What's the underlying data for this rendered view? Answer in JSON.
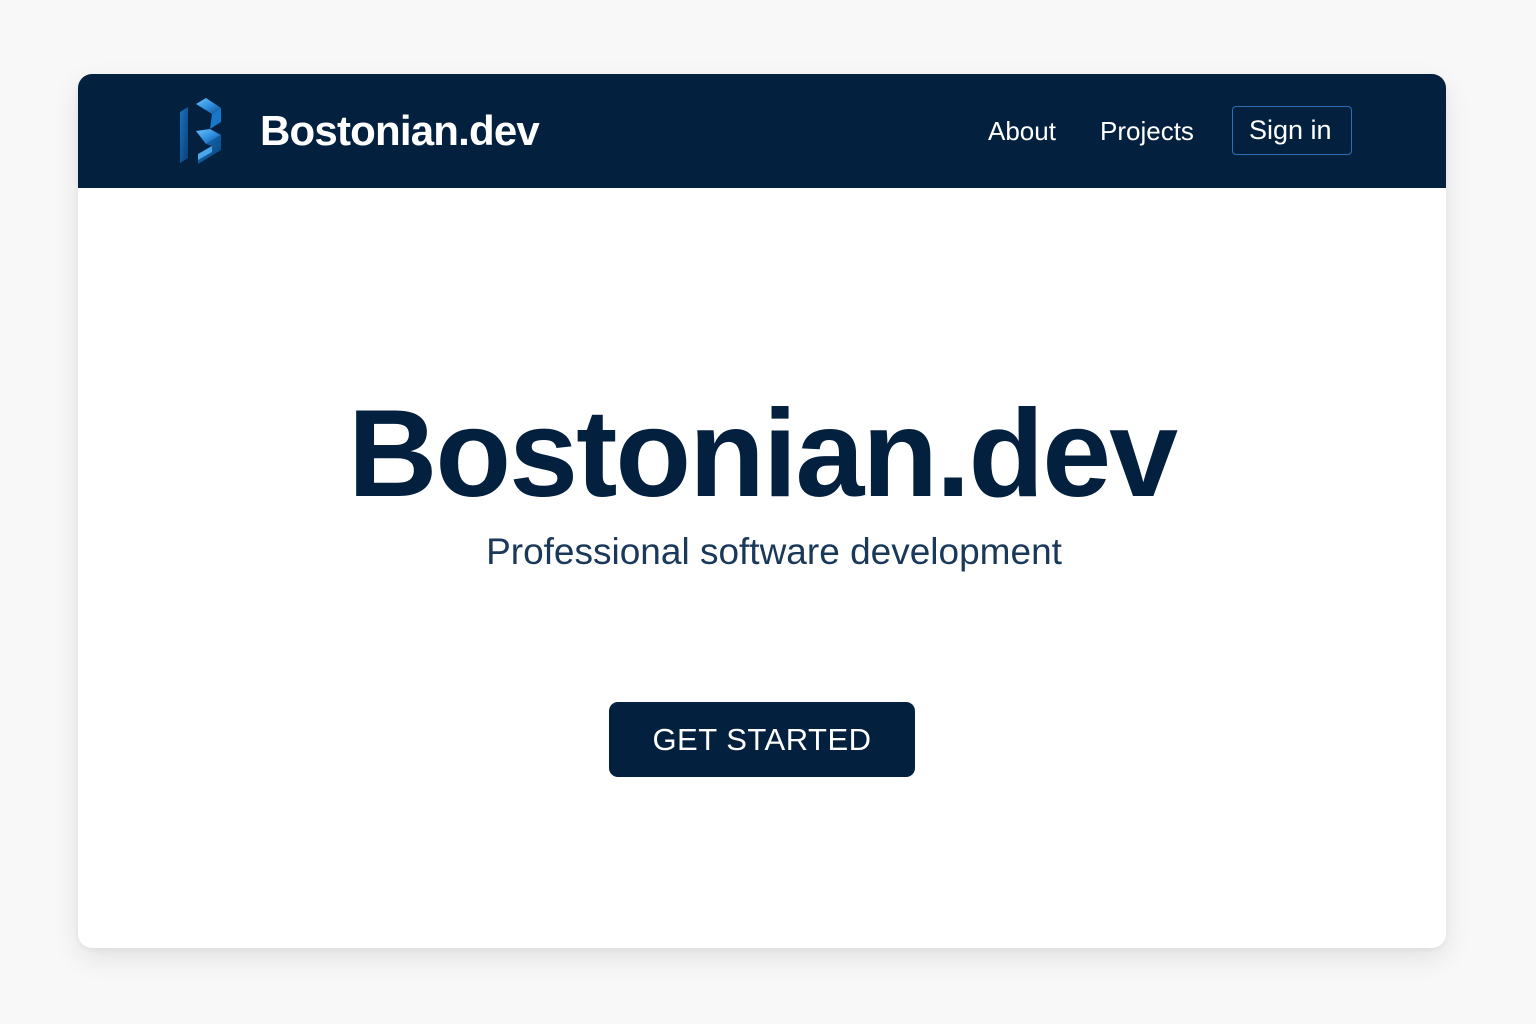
{
  "colors": {
    "page_background": "#f8f8f8",
    "navbar_background": "#03203f",
    "primary_navy": "#03203f",
    "subtitle_text": "#19385a",
    "signin_border": "#2c6fb4",
    "logo_blue": "#3d9ce8"
  },
  "header": {
    "logo_icon": "stylized-b-logo-icon",
    "brand_name": "Bostonian.dev",
    "nav_links": [
      {
        "label": "About"
      },
      {
        "label": "Projects"
      }
    ],
    "sign_in_label": "Sign in"
  },
  "hero": {
    "title": "Bostonian.dev",
    "subtitle": "Professional software development",
    "cta_label": "GET STARTED"
  }
}
